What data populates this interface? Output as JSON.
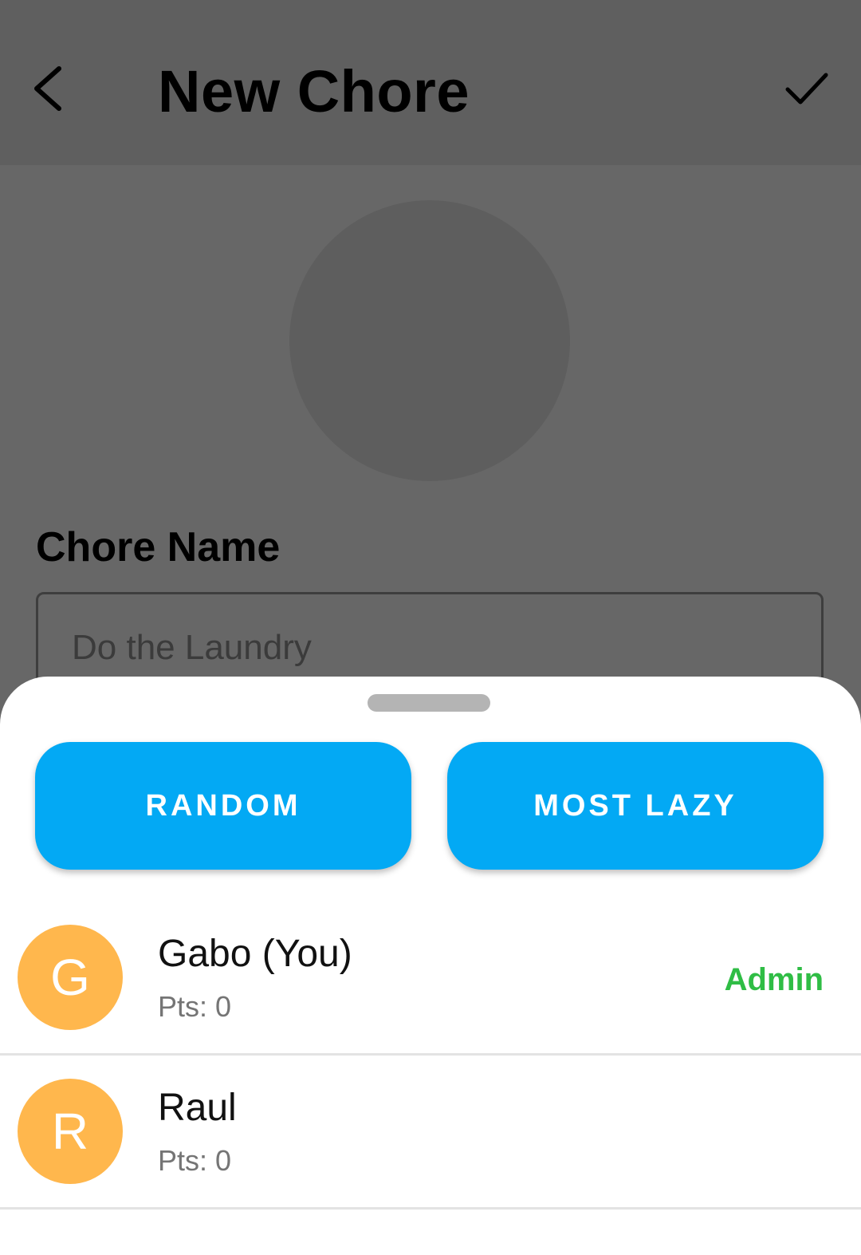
{
  "header": {
    "title": "New Chore"
  },
  "form": {
    "chore_name_label": "Chore Name",
    "chore_name_placeholder": "Do the Laundry"
  },
  "sheet": {
    "buttons": {
      "random": "RANDOM",
      "most_lazy": "MOST LAZY"
    },
    "members": [
      {
        "initial": "G",
        "name": "Gabo (You)",
        "points": "Pts: 0",
        "role": "Admin"
      },
      {
        "initial": "R",
        "name": "Raul",
        "points": "Pts: 0",
        "role": ""
      }
    ]
  },
  "icons": {
    "back": "back-arrow-icon",
    "save": "check-icon"
  },
  "colors": {
    "accent": "#03a9f4",
    "avatar": "#ffb74d",
    "admin_badge": "#2fbd45",
    "overlay_background": "#676767"
  }
}
